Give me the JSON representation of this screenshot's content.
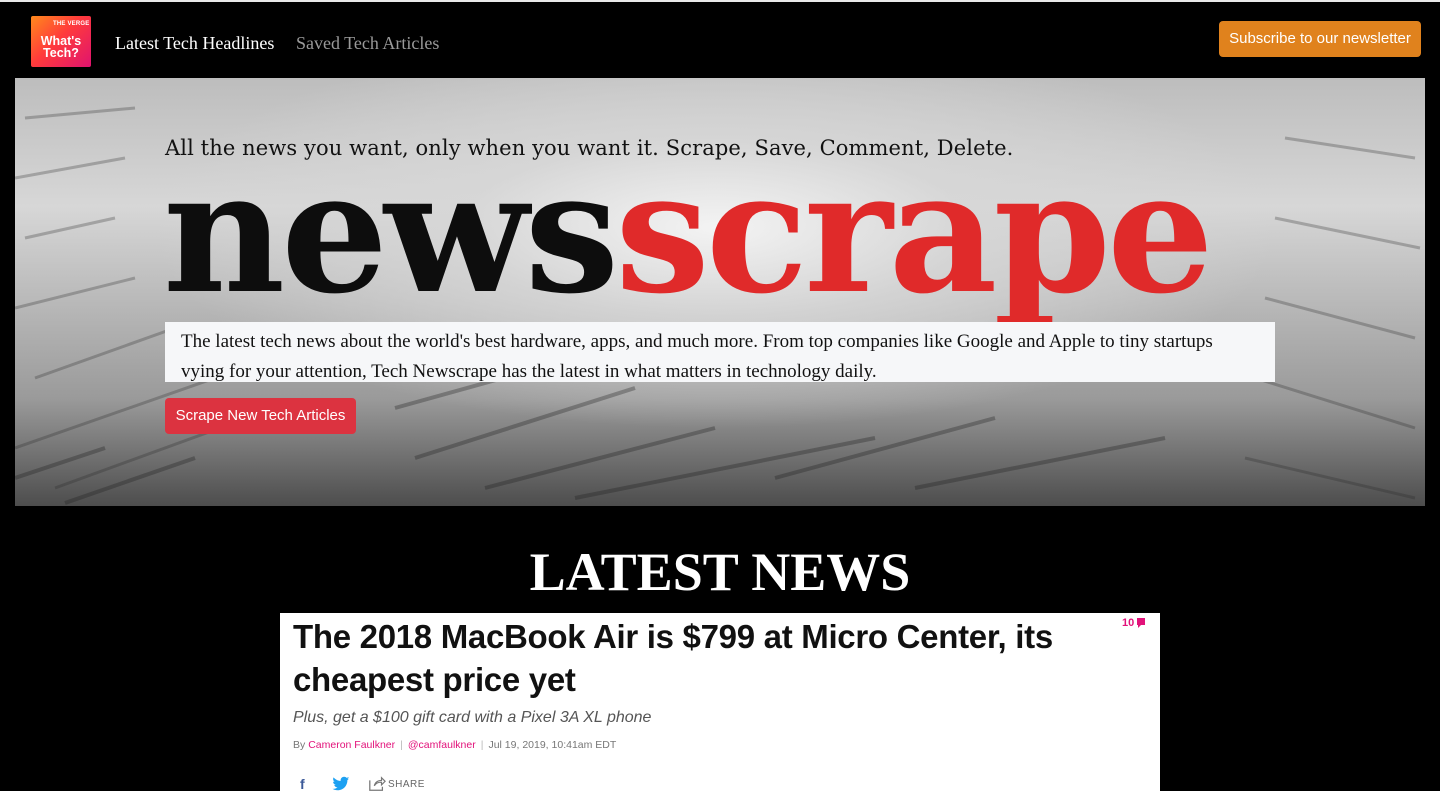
{
  "nav": {
    "logo_top": "THE VERGE",
    "logo_line1": "What's",
    "logo_line2": "Tech?",
    "links": [
      "Latest Tech Headlines",
      "Saved Tech Articles"
    ],
    "subscribe_label": "Subscribe to our newsletter"
  },
  "hero": {
    "tagline": "All the news you want, only when you want it. Scrape, Save, Comment, Delete.",
    "brand_part1": "news",
    "brand_part2": "scrape",
    "description": "The latest tech news about the world's best hardware, apps, and much more. From top companies like Google and Apple to tiny startups vying for your attention, Tech Newscrape has the latest in what matters in technology daily.",
    "scrape_button": "Scrape New Tech Articles"
  },
  "latest": {
    "title": "LATEST NEWS",
    "article": {
      "headline": "The 2018 MacBook Air is $799 at Micro Center, its cheapest price yet",
      "comments": "10",
      "dek": "Plus, get a $100 gift card with a Pixel 3A XL phone",
      "by": "By",
      "author": "Cameron Faulkner",
      "handle": "@camfaulkner",
      "date": "Jul 19, 2019, 10:41am EDT",
      "share_label": "SHARE"
    }
  },
  "colors": {
    "subscribe": "#e0821d",
    "scrape_button": "#dc3340",
    "brand_red": "#e02a2a",
    "verge_pink": "#e2127a"
  }
}
